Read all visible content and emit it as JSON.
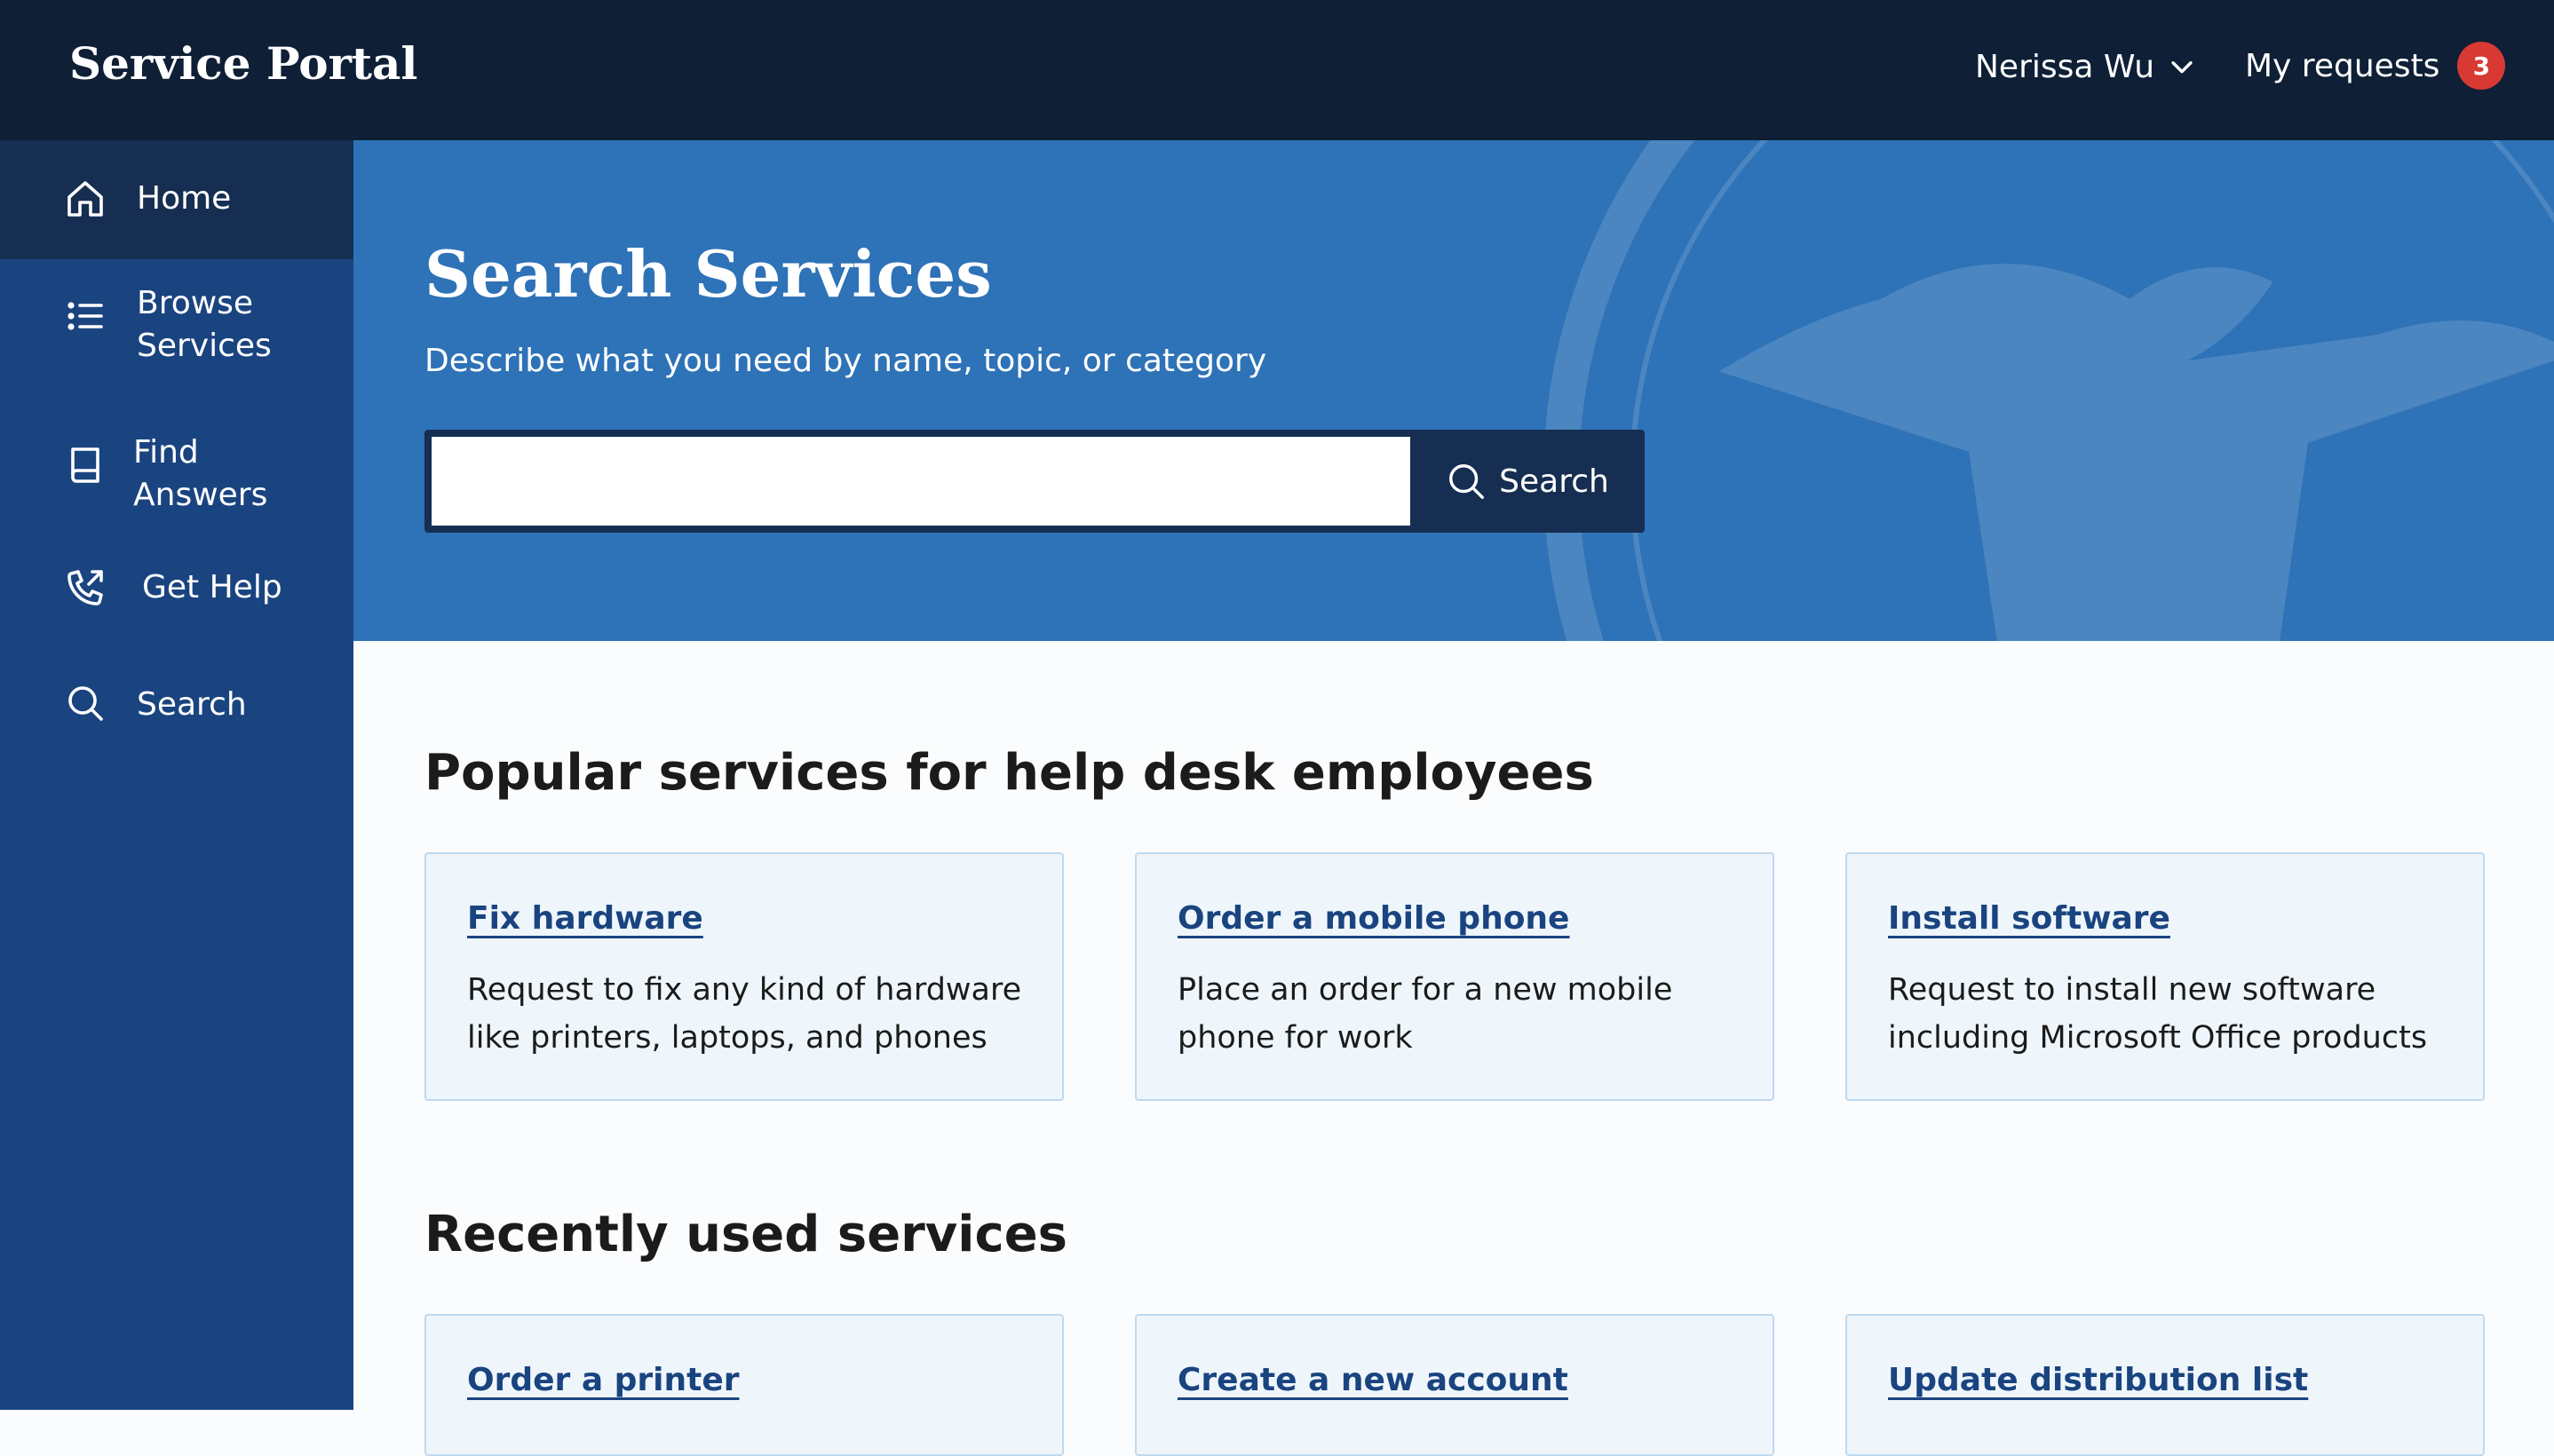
{
  "header": {
    "brand": "Service Portal",
    "user_name": "Nerissa Wu",
    "requests_label": "My requests",
    "requests_count": "3"
  },
  "sidebar": {
    "items": [
      {
        "label": "Home",
        "icon": "home-icon",
        "active": true
      },
      {
        "label": "Browse Services",
        "icon": "list-icon"
      },
      {
        "label": "Find Answers",
        "icon": "book-icon"
      },
      {
        "label": "Get Help",
        "icon": "phone-icon"
      },
      {
        "label": "Search",
        "icon": "search-icon"
      }
    ]
  },
  "hero": {
    "title": "Search Services",
    "subtitle": "Describe what you need by name, topic, or category",
    "search_value": "",
    "search_button": "Search"
  },
  "popular": {
    "heading": "Popular services for help desk employees",
    "cards": [
      {
        "title": "Fix hardware",
        "desc": "Request to fix any kind of hardware like printers, laptops, and phones"
      },
      {
        "title": "Order a mobile phone",
        "desc": "Place an order for a new mobile phone for work"
      },
      {
        "title": "Install software",
        "desc": "Request to install new software including Microsoft Office products"
      }
    ]
  },
  "recent": {
    "heading": "Recently used services",
    "cards": [
      {
        "title": "Order a printer"
      },
      {
        "title": "Create a new account"
      },
      {
        "title": "Update distribution list"
      }
    ]
  },
  "colors": {
    "header_bg": "#0e1f36",
    "sidebar_bg": "#1a4480",
    "sidebar_active": "#162e51",
    "hero_bg": "#2e72b7",
    "badge": "#d83933",
    "link": "#1a4480"
  }
}
